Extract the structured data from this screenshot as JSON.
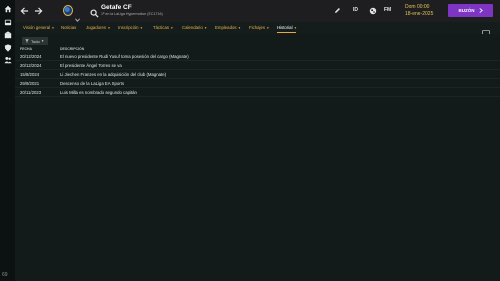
{
  "sidebar": {
    "icons": [
      "home-icon",
      "inbox-icon",
      "club-icon",
      "shield-icon",
      "people-icon"
    ],
    "bottom_number": "69"
  },
  "topbar": {
    "team_name": "Getafe CF",
    "team_subtitle": "1ª en la LaLiga Hypermotion (EC1716)",
    "icons": [
      "pencil-icon",
      "id-icon",
      "globe-icon",
      "fm-icon"
    ],
    "id_label": "ID",
    "fm_label": "FM",
    "date_time": "Dom 00:00",
    "date_day": "18-ene-2025",
    "buzon_label": "BUZÓN",
    "colors": {
      "accent": "#7f35c4",
      "date": "#e1c65a"
    }
  },
  "tabs": [
    {
      "label": "Visión general",
      "active": false
    },
    {
      "label": "Noticias",
      "active": false
    },
    {
      "label": "Jugadores",
      "active": false
    },
    {
      "label": "Inscripción",
      "active": false
    },
    {
      "label": "Tácticas",
      "active": false
    },
    {
      "label": "Calendario",
      "active": false
    },
    {
      "label": "Empleados",
      "active": false
    },
    {
      "label": "Fichajes",
      "active": false
    },
    {
      "label": "Historial",
      "active": true
    }
  ],
  "filter_label": "Todo",
  "table": {
    "headers": {
      "date": "FECHA",
      "description": "DESCRIPCIÓN"
    },
    "rows": [
      {
        "date": "20/12/2024",
        "description": "El nuevo presidente Rudi Yusuf toma posesión del cargo (Magnate)"
      },
      {
        "date": "20/12/2024",
        "description": "El presidente Ángel Torres se va"
      },
      {
        "date": "15/8/2024",
        "description": "Li Jiechen Franzes en la adquisición del club (Magnate)"
      },
      {
        "date": "29/9/2021",
        "description": "Descenso de la LaLiga EA Sports"
      },
      {
        "date": "20/11/2023",
        "description": "Luis Milla es nombrado segundo capitán"
      }
    ]
  }
}
